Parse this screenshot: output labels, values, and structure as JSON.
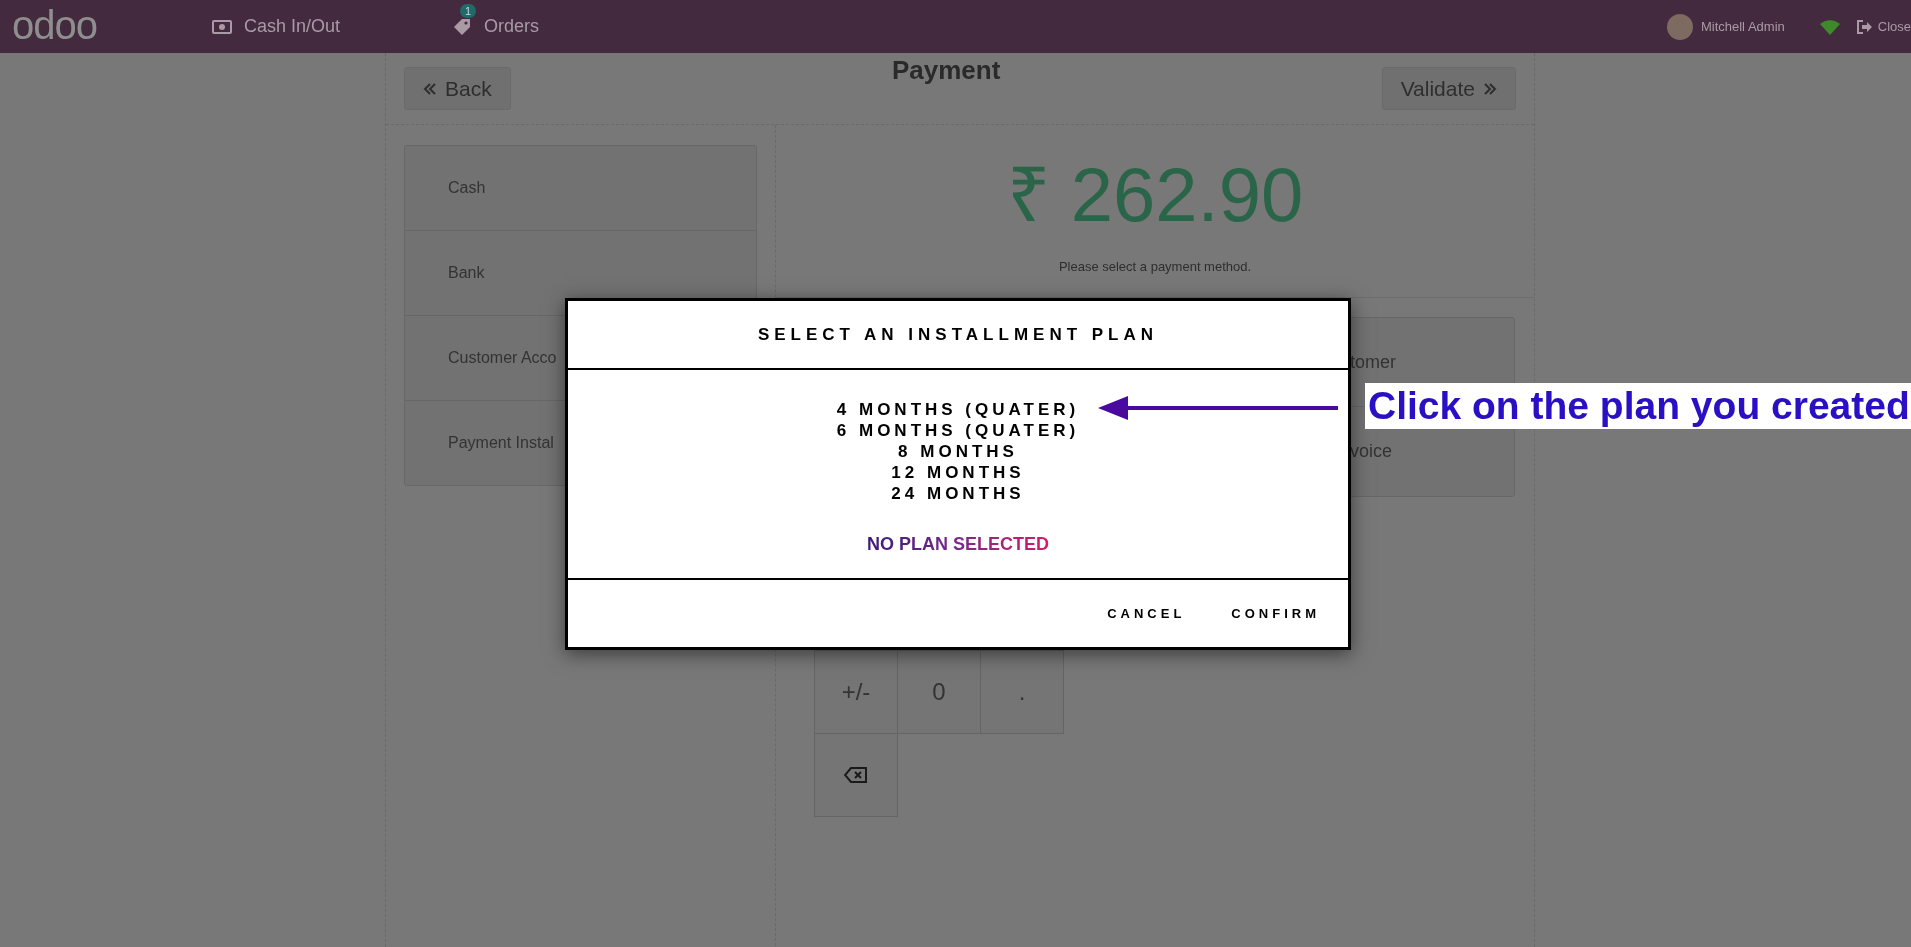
{
  "navbar": {
    "logo": "odoo",
    "items": [
      {
        "label": "Cash In/Out"
      },
      {
        "label": "Orders",
        "badge": "1"
      }
    ],
    "user": "Mitchell Admin",
    "close": "Close"
  },
  "payment": {
    "title": "Payment",
    "back": "Back",
    "validate": "Validate",
    "methods": [
      "Cash",
      "Bank",
      "Customer Acco",
      "Payment Instal"
    ],
    "amount": "₹ 262.90",
    "hint": "Please select a payment method.",
    "side_buttons": [
      "tomer",
      "voice"
    ],
    "keys": [
      {
        "kind": "text",
        "label": "+/-"
      },
      {
        "kind": "text",
        "label": "0"
      },
      {
        "kind": "text",
        "label": "."
      },
      {
        "kind": "backspace"
      }
    ]
  },
  "dialog": {
    "title": "SELECT AN INSTALLMENT PLAN",
    "plans": [
      {
        "label": "4 MONTHS (QUATER)",
        "selected": false
      },
      {
        "label": "6 MONTHS (QUATER)",
        "selected": false
      },
      {
        "label": "8 MONTHS",
        "selected": false
      },
      {
        "label": "12 MONTHS",
        "selected": false
      },
      {
        "label": "24 MONTHS",
        "selected": false
      }
    ],
    "status": "NO PLAN SELECTED",
    "buttons": [
      "CANCEL",
      "CONFIRM"
    ]
  },
  "annotation": {
    "text": "Click on the plan you created"
  }
}
